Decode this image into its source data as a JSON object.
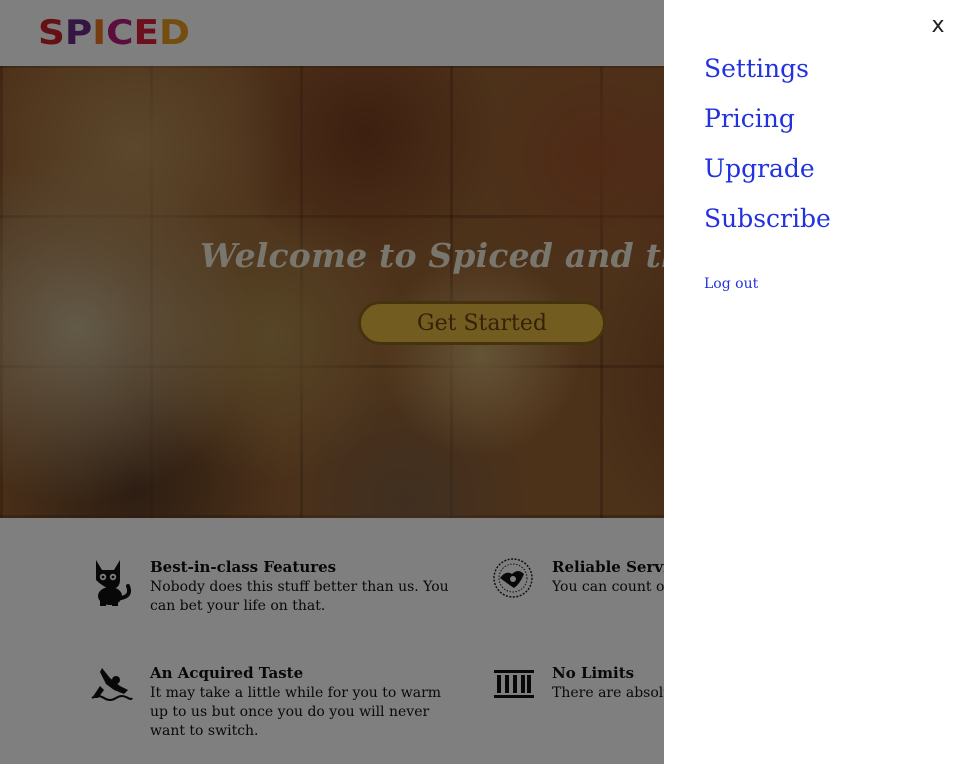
{
  "colors": {
    "link": "#2233dd",
    "cta_fill": "#e7b93e",
    "cta_border": "#8a641e",
    "overlay": "rgba(0,0,0,0.5)"
  },
  "header": {
    "logo_text": "SPICED",
    "logo_colors": [
      "#c8202a",
      "#6b2a82",
      "#e8781e",
      "#b8187a",
      "#d8203a",
      "#e89a1e"
    ]
  },
  "hero": {
    "title": "Welcome to Spiced and the F",
    "cta_label": "Get Started"
  },
  "features": [
    {
      "icon": "cat-icon",
      "title": "Best-in-class Features",
      "body": "Nobody does this stuff better than us. You can bet your life on that."
    },
    {
      "icon": "globe-icon",
      "title": "Reliable Servi",
      "body": "You can count o you need it. We' service."
    },
    {
      "icon": "swimmer-icon",
      "title": "An Acquired Taste",
      "body": "It may take a little while for you to warm up to us but once you do you will never want to switch."
    },
    {
      "icon": "columns-icon",
      "title": "No Limits",
      "body": "There are absolu throttle. We do"
    }
  ],
  "drawer": {
    "close_label": "x",
    "menu": [
      {
        "label": "Settings"
      },
      {
        "label": "Pricing"
      },
      {
        "label": "Upgrade"
      },
      {
        "label": "Subscribe"
      }
    ],
    "logout_label": "Log out"
  }
}
